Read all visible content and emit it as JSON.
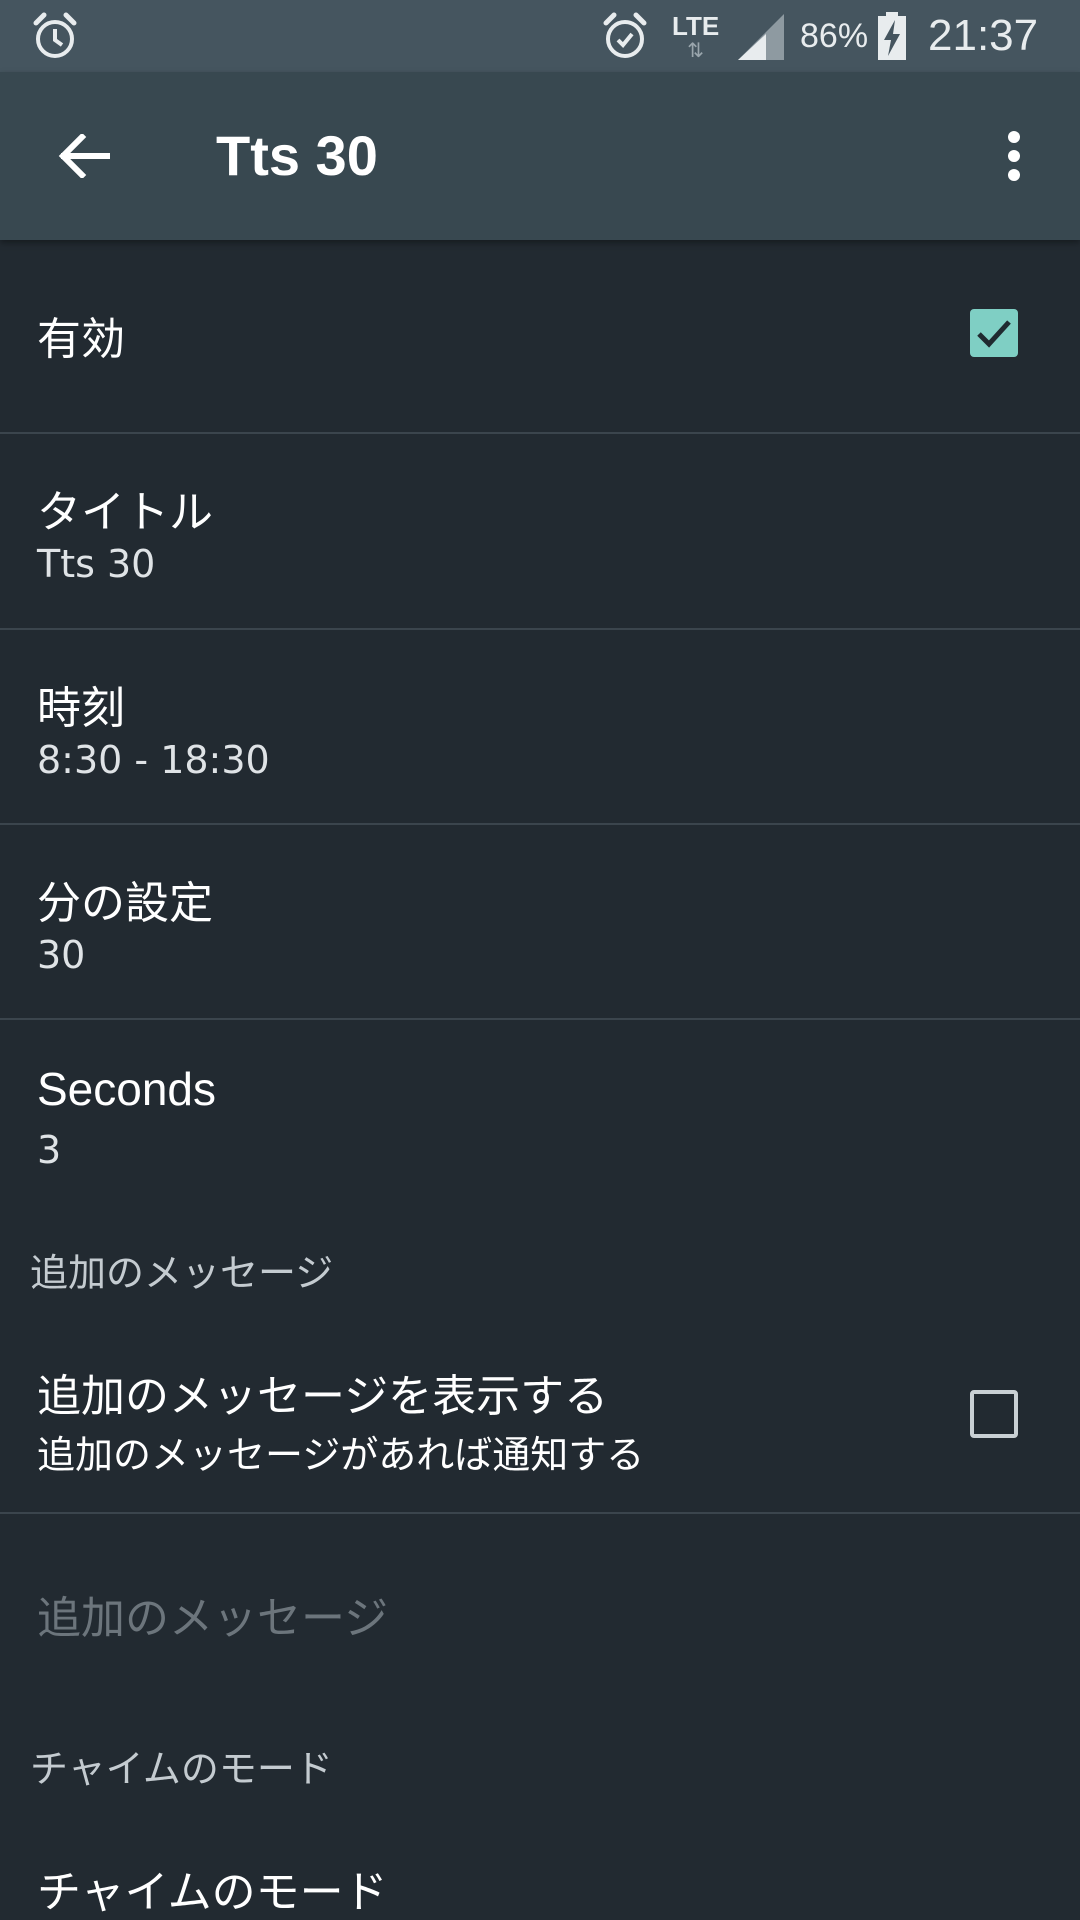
{
  "status_bar": {
    "network": "LTE",
    "battery": "86%",
    "time": "21:37",
    "icons": [
      "alarm-icon",
      "alarm-icon",
      "signal-icon",
      "battery-charging-icon"
    ]
  },
  "toolbar": {
    "title": "Tts 30",
    "back_icon": "arrow-back-icon",
    "menu_icon": "more-vert-icon"
  },
  "settings": {
    "enabled": {
      "label": "有効",
      "checked": true
    },
    "title": {
      "label": "タイトル",
      "value": "Tts 30"
    },
    "time": {
      "label": "時刻",
      "value": "8:30 - 18:30"
    },
    "minutes": {
      "label": "分の設定",
      "value": "30"
    },
    "seconds": {
      "label": "Seconds",
      "value": "3"
    },
    "extra_category": "追加のメッセージ",
    "show_extra": {
      "label": "追加のメッセージを表示する",
      "summary": "追加のメッセージがあれば通知する",
      "checked": false
    },
    "extra_message": {
      "label": "追加のメッセージ",
      "enabled": false
    },
    "chime_category": "チャイムのモード",
    "chime_mode": {
      "label": "チャイムのモード"
    }
  },
  "colors": {
    "background": "#222a31",
    "toolbar": "#384850",
    "status_bar": "#45555f",
    "accent": "#7fcfc4"
  }
}
